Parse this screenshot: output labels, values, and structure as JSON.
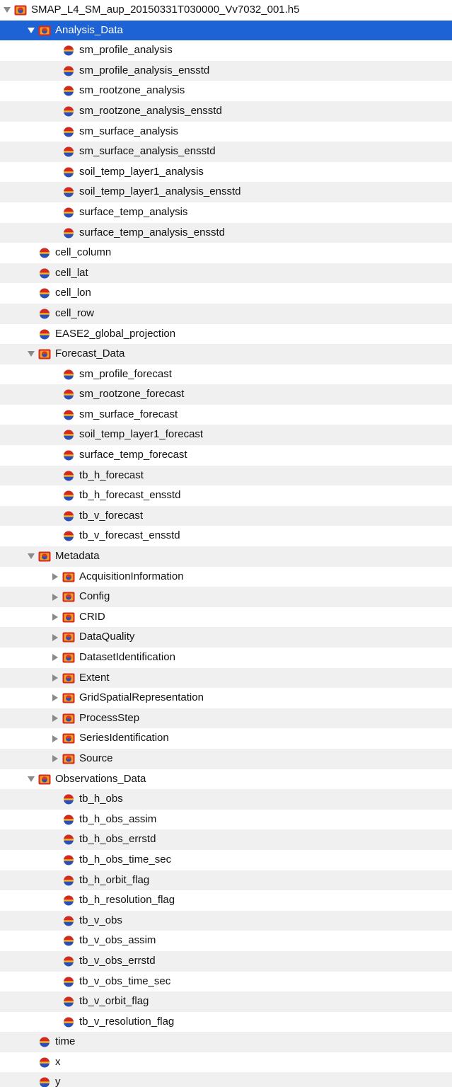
{
  "tree": {
    "rows": [
      {
        "label": "SMAP_L4_SM_aup_20150331T030000_Vv7032_001.h5",
        "level": 0,
        "kind": "group",
        "toggle": "expanded",
        "icon": "hdf-group-icon"
      },
      {
        "label": "Analysis_Data",
        "level": 1,
        "kind": "group",
        "toggle": "expanded",
        "selected": true,
        "icon": "hdf-group-icon"
      },
      {
        "label": "sm_profile_analysis",
        "level": 2,
        "kind": "dataset",
        "icon": "hdf-dataset-icon"
      },
      {
        "label": "sm_profile_analysis_ensstd",
        "level": 2,
        "kind": "dataset",
        "icon": "hdf-dataset-icon"
      },
      {
        "label": "sm_rootzone_analysis",
        "level": 2,
        "kind": "dataset",
        "icon": "hdf-dataset-icon"
      },
      {
        "label": "sm_rootzone_analysis_ensstd",
        "level": 2,
        "kind": "dataset",
        "icon": "hdf-dataset-icon"
      },
      {
        "label": "sm_surface_analysis",
        "level": 2,
        "kind": "dataset",
        "icon": "hdf-dataset-icon"
      },
      {
        "label": "sm_surface_analysis_ensstd",
        "level": 2,
        "kind": "dataset",
        "icon": "hdf-dataset-icon"
      },
      {
        "label": "soil_temp_layer1_analysis",
        "level": 2,
        "kind": "dataset",
        "icon": "hdf-dataset-icon"
      },
      {
        "label": "soil_temp_layer1_analysis_ensstd",
        "level": 2,
        "kind": "dataset",
        "icon": "hdf-dataset-icon"
      },
      {
        "label": "surface_temp_analysis",
        "level": 2,
        "kind": "dataset",
        "icon": "hdf-dataset-icon"
      },
      {
        "label": "surface_temp_analysis_ensstd",
        "level": 2,
        "kind": "dataset",
        "icon": "hdf-dataset-icon"
      },
      {
        "label": "cell_column",
        "level": 1,
        "kind": "dataset",
        "icon": "hdf-dataset-icon"
      },
      {
        "label": "cell_lat",
        "level": 1,
        "kind": "dataset",
        "icon": "hdf-dataset-icon"
      },
      {
        "label": "cell_lon",
        "level": 1,
        "kind": "dataset",
        "icon": "hdf-dataset-icon"
      },
      {
        "label": "cell_row",
        "level": 1,
        "kind": "dataset",
        "icon": "hdf-dataset-icon"
      },
      {
        "label": "EASE2_global_projection",
        "level": 1,
        "kind": "dataset",
        "icon": "hdf-dataset-icon"
      },
      {
        "label": "Forecast_Data",
        "level": 1,
        "kind": "group",
        "toggle": "expanded",
        "icon": "hdf-group-icon"
      },
      {
        "label": "sm_profile_forecast",
        "level": 2,
        "kind": "dataset",
        "icon": "hdf-dataset-icon"
      },
      {
        "label": "sm_rootzone_forecast",
        "level": 2,
        "kind": "dataset",
        "icon": "hdf-dataset-icon"
      },
      {
        "label": "sm_surface_forecast",
        "level": 2,
        "kind": "dataset",
        "icon": "hdf-dataset-icon"
      },
      {
        "label": "soil_temp_layer1_forecast",
        "level": 2,
        "kind": "dataset",
        "icon": "hdf-dataset-icon"
      },
      {
        "label": "surface_temp_forecast",
        "level": 2,
        "kind": "dataset",
        "icon": "hdf-dataset-icon"
      },
      {
        "label": "tb_h_forecast",
        "level": 2,
        "kind": "dataset",
        "icon": "hdf-dataset-icon"
      },
      {
        "label": "tb_h_forecast_ensstd",
        "level": 2,
        "kind": "dataset",
        "icon": "hdf-dataset-icon"
      },
      {
        "label": "tb_v_forecast",
        "level": 2,
        "kind": "dataset",
        "icon": "hdf-dataset-icon"
      },
      {
        "label": "tb_v_forecast_ensstd",
        "level": 2,
        "kind": "dataset",
        "icon": "hdf-dataset-icon"
      },
      {
        "label": "Metadata",
        "level": 1,
        "kind": "group",
        "toggle": "expanded",
        "icon": "hdf-group-icon"
      },
      {
        "label": "AcquisitionInformation",
        "level": 2,
        "kind": "group",
        "toggle": "collapsed",
        "icon": "hdf-group-icon"
      },
      {
        "label": "Config",
        "level": 2,
        "kind": "group",
        "toggle": "collapsed",
        "icon": "hdf-group-icon"
      },
      {
        "label": "CRID",
        "level": 2,
        "kind": "group",
        "toggle": "collapsed",
        "icon": "hdf-group-icon"
      },
      {
        "label": "DataQuality",
        "level": 2,
        "kind": "group",
        "toggle": "collapsed",
        "icon": "hdf-group-icon"
      },
      {
        "label": "DatasetIdentification",
        "level": 2,
        "kind": "group",
        "toggle": "collapsed",
        "icon": "hdf-group-icon"
      },
      {
        "label": "Extent",
        "level": 2,
        "kind": "group",
        "toggle": "collapsed",
        "icon": "hdf-group-icon"
      },
      {
        "label": "GridSpatialRepresentation",
        "level": 2,
        "kind": "group",
        "toggle": "collapsed",
        "icon": "hdf-group-icon"
      },
      {
        "label": "ProcessStep",
        "level": 2,
        "kind": "group",
        "toggle": "collapsed",
        "icon": "hdf-group-icon"
      },
      {
        "label": "SeriesIdentification",
        "level": 2,
        "kind": "group",
        "toggle": "collapsed",
        "icon": "hdf-group-icon"
      },
      {
        "label": "Source",
        "level": 2,
        "kind": "group",
        "toggle": "collapsed",
        "icon": "hdf-group-icon"
      },
      {
        "label": "Observations_Data",
        "level": 1,
        "kind": "group",
        "toggle": "expanded",
        "icon": "hdf-group-icon"
      },
      {
        "label": "tb_h_obs",
        "level": 2,
        "kind": "dataset",
        "icon": "hdf-dataset-icon"
      },
      {
        "label": "tb_h_obs_assim",
        "level": 2,
        "kind": "dataset",
        "icon": "hdf-dataset-icon"
      },
      {
        "label": "tb_h_obs_errstd",
        "level": 2,
        "kind": "dataset",
        "icon": "hdf-dataset-icon"
      },
      {
        "label": "tb_h_obs_time_sec",
        "level": 2,
        "kind": "dataset",
        "icon": "hdf-dataset-icon"
      },
      {
        "label": "tb_h_orbit_flag",
        "level": 2,
        "kind": "dataset",
        "icon": "hdf-dataset-icon"
      },
      {
        "label": "tb_h_resolution_flag",
        "level": 2,
        "kind": "dataset",
        "icon": "hdf-dataset-icon"
      },
      {
        "label": "tb_v_obs",
        "level": 2,
        "kind": "dataset",
        "icon": "hdf-dataset-icon"
      },
      {
        "label": "tb_v_obs_assim",
        "level": 2,
        "kind": "dataset",
        "icon": "hdf-dataset-icon"
      },
      {
        "label": "tb_v_obs_errstd",
        "level": 2,
        "kind": "dataset",
        "icon": "hdf-dataset-icon"
      },
      {
        "label": "tb_v_obs_time_sec",
        "level": 2,
        "kind": "dataset",
        "icon": "hdf-dataset-icon"
      },
      {
        "label": "tb_v_orbit_flag",
        "level": 2,
        "kind": "dataset",
        "icon": "hdf-dataset-icon"
      },
      {
        "label": "tb_v_resolution_flag",
        "level": 2,
        "kind": "dataset",
        "icon": "hdf-dataset-icon"
      },
      {
        "label": "time",
        "level": 1,
        "kind": "dataset",
        "icon": "hdf-dataset-icon"
      },
      {
        "label": "x",
        "level": 1,
        "kind": "dataset",
        "icon": "hdf-dataset-icon"
      },
      {
        "label": "y",
        "level": 1,
        "kind": "dataset",
        "icon": "hdf-dataset-icon"
      }
    ],
    "colors": {
      "selection": "#1d63d6",
      "stripe": "#f0f0f0",
      "toggle": "#8a8a8a",
      "icon_red": "#d42a1e",
      "icon_orange": "#f0a020",
      "icon_blue": "#2a4fb8"
    }
  }
}
